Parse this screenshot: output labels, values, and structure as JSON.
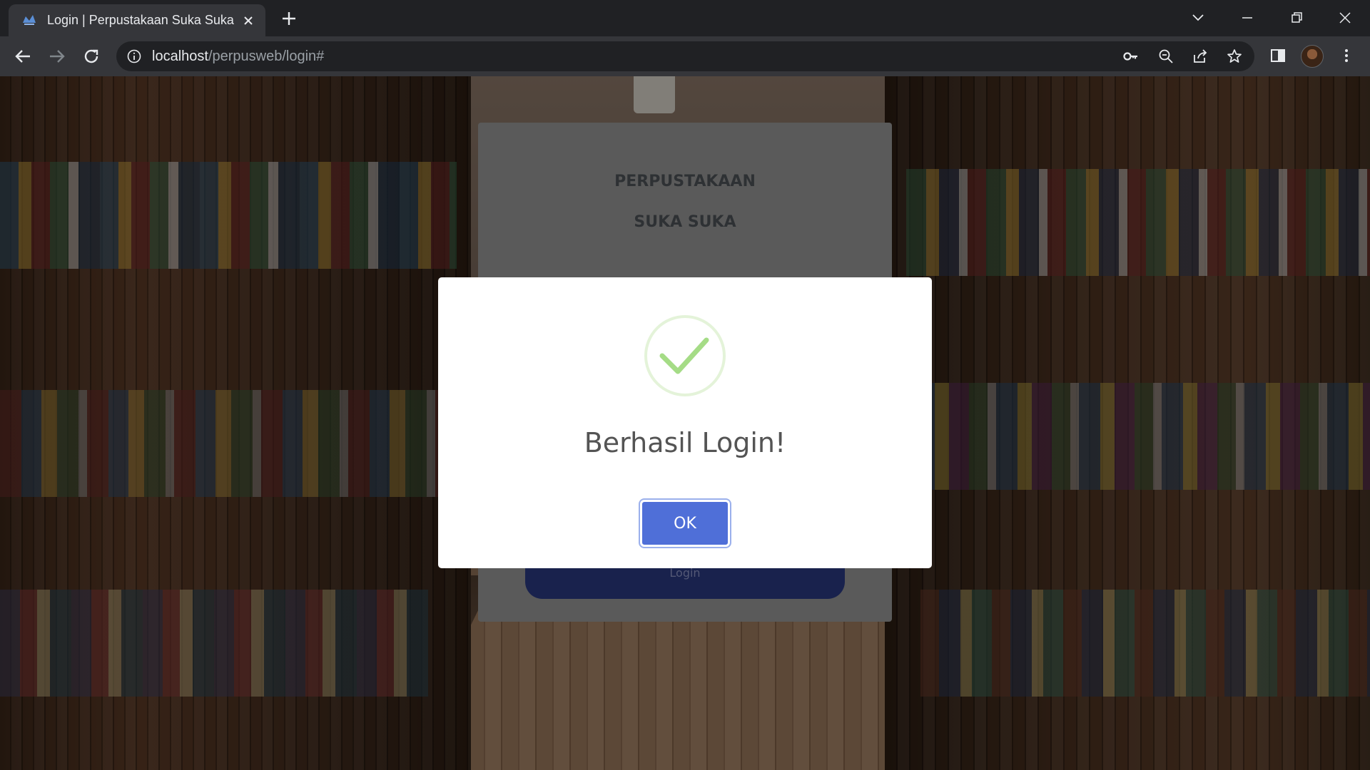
{
  "browser": {
    "tab_title": "Login | Perpustakaan Suka Suka",
    "url_host": "localhost",
    "url_path": "/perpusweb/login#"
  },
  "page": {
    "brand_line1": "PERPUSTAKAAN",
    "brand_line2": "SUKA SUKA",
    "login_button": "Login"
  },
  "alert": {
    "icon": "success-check-icon",
    "title": "Berhasil Login!",
    "confirm_label": "OK"
  },
  "colors": {
    "chrome_dark": "#202124",
    "chrome_toolbar": "#35363a",
    "success_green": "#a5dc86",
    "confirm_blue": "#4f6fd8"
  }
}
